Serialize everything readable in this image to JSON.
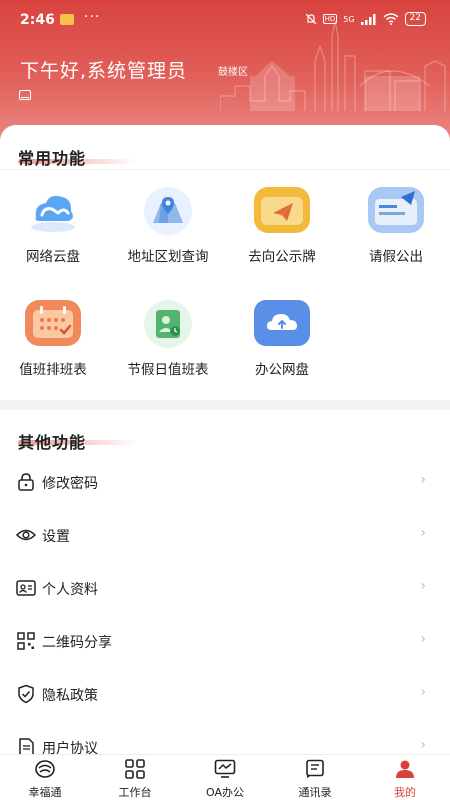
{
  "status_bar": {
    "time": "2:46",
    "more": "···",
    "network": "5G",
    "hd": "HD",
    "battery": "22"
  },
  "header": {
    "greeting": "下午好,系统管理员",
    "district": "鼓楼区"
  },
  "common": {
    "title": "常用功能",
    "items": [
      {
        "label": "网络云盘",
        "icon": "cloud-drive-icon"
      },
      {
        "label": "地址区划查询",
        "icon": "map-pin-icon"
      },
      {
        "label": "去向公示牌",
        "icon": "paper-plane-icon"
      },
      {
        "label": "请假公出",
        "icon": "leave-form-icon"
      },
      {
        "label": "值班排班表",
        "icon": "calendar-icon"
      },
      {
        "label": "节假日值班表",
        "icon": "holiday-duty-icon"
      },
      {
        "label": "办公网盘",
        "icon": "cloud-upload-icon"
      }
    ]
  },
  "other": {
    "title": "其他功能",
    "items": [
      {
        "label": "修改密码",
        "icon": "lock-icon"
      },
      {
        "label": "设置",
        "icon": "eye-icon"
      },
      {
        "label": "个人资料",
        "icon": "id-card-icon"
      },
      {
        "label": "二维码分享",
        "icon": "qr-code-icon"
      },
      {
        "label": "隐私政策",
        "icon": "shield-check-icon"
      },
      {
        "label": "用户协议",
        "icon": "document-icon"
      }
    ],
    "chevron": "›"
  },
  "tabbar": {
    "items": [
      {
        "label": "幸福通",
        "icon": "happiness-icon"
      },
      {
        "label": "工作台",
        "icon": "grid-icon"
      },
      {
        "label": "OA办公",
        "icon": "monitor-icon"
      },
      {
        "label": "通讯录",
        "icon": "contacts-icon"
      },
      {
        "label": "我的",
        "icon": "user-icon"
      }
    ],
    "active_index": 4
  },
  "colors": {
    "brand": "#d8403c",
    "text": "#222222",
    "muted": "#bbbbbb"
  }
}
